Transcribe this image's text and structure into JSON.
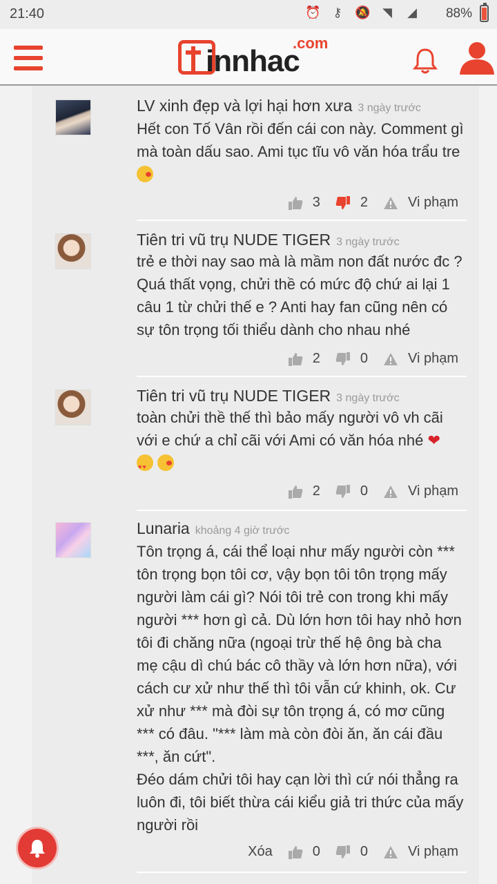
{
  "status_bar": {
    "time": "21:40",
    "battery": "88%"
  },
  "header": {
    "logo_text": "innhac",
    "logo_domain": ".com"
  },
  "comments": [
    {
      "name": "LV xinh đẹp và lợi hại hơn xưa",
      "time": "3 ngày trước",
      "body": "Hết con Tố Vân rồi đến cái con này. Comment gì mà toàn dấu sao. Ami tục tĩu vô văn hóa trẩu tre",
      "likes": "3",
      "dislikes": "2",
      "report": "Vi phạm"
    },
    {
      "name": "Tiên tri vũ trụ NUDE TIGER",
      "time": "3 ngày trước",
      "body": "trẻ e thời nay sao mà là mầm non đất nước đc ? Quá thất vọng, chửi thề có mức độ chứ ai lại 1 câu 1 từ chửi thế e ? Anti hay fan cũng nên có sự tôn trọng tối thiểu dành cho nhau nhé",
      "likes": "2",
      "dislikes": "0",
      "report": "Vi phạm"
    },
    {
      "name": "Tiên tri vũ trụ NUDE TIGER",
      "time": "3 ngày trước",
      "body": "toàn chửi thề thế thì bảo mấy người vô vh cãi với e chứ a chỉ cãi với Ami có văn hóa nhé",
      "likes": "2",
      "dislikes": "0",
      "report": "Vi phạm"
    },
    {
      "name": "Lunaria",
      "time": "khoảng 4 giờ trước",
      "body": "Tôn trọng á, cái thể loại như mấy người còn *** tôn trọng bọn tôi cơ, vậy bọn tôi tôn trọng mấy người làm cái gì? Nói tôi trẻ con trong khi mấy người *** hơn gì cả. Dù lớn hơn tôi hay nhỏ hơn tôi đi chăng nữa (ngoại trừ thế hệ ông bà cha mẹ cậu dì chú bác cô thầy và lớn hơn nữa), với cách cư xử như thế thì tôi vẫn cứ khinh, ok. Cư xử như *** mà đòi sự tôn trọng á, có mơ cũng *** có đâu. \"*** làm mà còn đòi ăn, ăn cái đầu ***, ăn cứt\".",
      "body2": "Đéo dám chửi tôi hay cạn lời thì cứ nói thẳng ra luôn đi, tôi biết thừa cái kiểu giả tri thức của mấy người rồi",
      "delete": "Xóa",
      "likes": "0",
      "dislikes": "0",
      "report": "Vi phạm"
    }
  ]
}
